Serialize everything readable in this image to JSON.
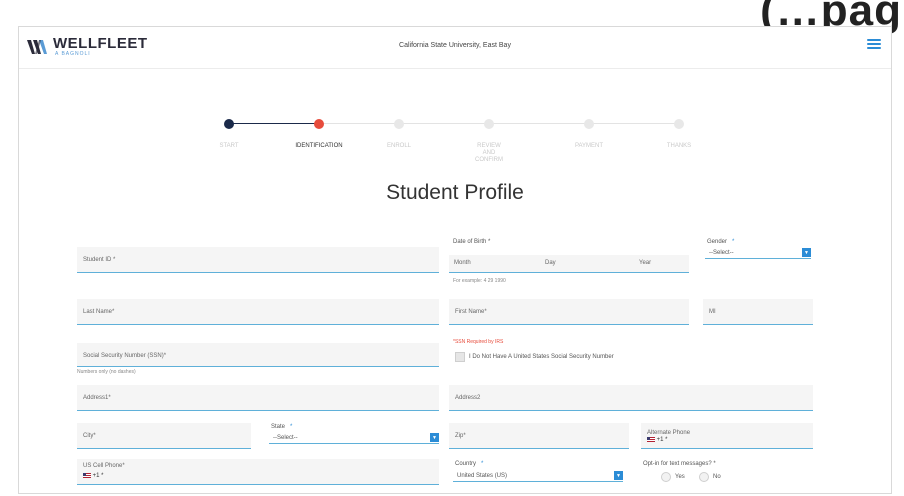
{
  "slide": {
    "title_fragment": "(…pag"
  },
  "header": {
    "logo_text": "WELLFLEET",
    "logo_sub": "A BAGNOLI",
    "university": "California State University, East Bay"
  },
  "steps": [
    {
      "label": "START",
      "state": "done"
    },
    {
      "label": "IDENTIFICATION",
      "state": "current"
    },
    {
      "label": "ENROLL",
      "state": "pending"
    },
    {
      "label": "REVIEW\nAND\nCONFIRM",
      "state": "pending"
    },
    {
      "label": "PAYMENT",
      "state": "pending"
    },
    {
      "label": "THANKS",
      "state": "pending"
    }
  ],
  "page_title": "Student Profile",
  "form": {
    "student_id": "Student ID *",
    "dob_label": "Date of Birth *",
    "dob_month": "Month",
    "dob_day": "Day",
    "dob_year": "Year",
    "dob_help": "For example: 4 29 1990",
    "gender_label": "Gender",
    "gender_value": "--Select--",
    "last_name": "Last Name*",
    "first_name": "First Name*",
    "mi": "MI",
    "ssn": "Social Security Number (SSN)*",
    "ssn_help": "Numbers only (no dashes)",
    "ssn_required_note": "*SSN Required by IRS",
    "no_ssn": "I Do Not Have A United States Social Security Number",
    "address1": "Address1*",
    "address2": "Address2",
    "city": "City*",
    "state_label": "State",
    "state_value": "--Select--",
    "zip": "Zip*",
    "alt_phone": "Alternate Phone",
    "alt_phone_value": "+1 *",
    "cell_phone": "US Cell Phone*",
    "cell_phone_value": "+1 *",
    "country_label": "Country",
    "country_value": "United States (US)",
    "opt_in": "Opt-in for text messages? *",
    "yes": "Yes",
    "no": "No",
    "required_mark": "*"
  },
  "colors": {
    "accent": "#2b8cd6",
    "active_step": "#1b2a4a",
    "current_step": "#e74c3c",
    "field_underline": "#5fb0d9"
  }
}
